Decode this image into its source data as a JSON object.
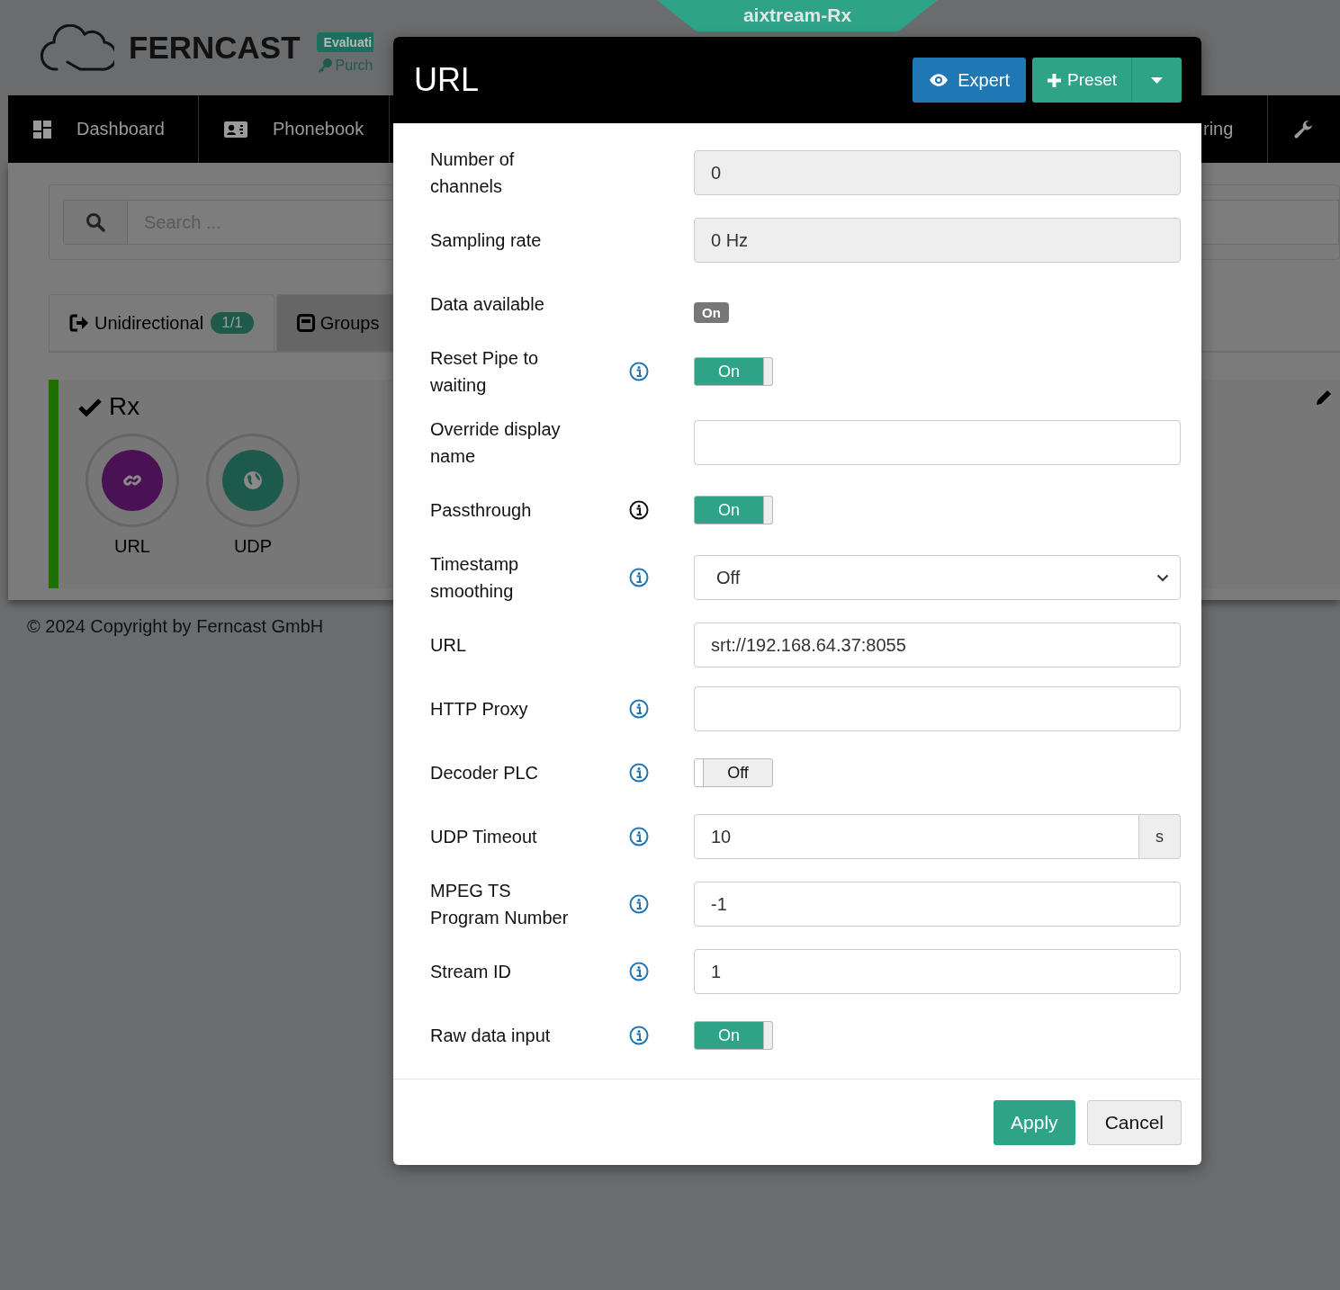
{
  "ribbon": {
    "title": "aixtream-Rx"
  },
  "header": {
    "brand": "FERNCAST",
    "badge": "Evaluati",
    "link": "Purch"
  },
  "nav": {
    "items": [
      {
        "label": "Dashboard"
      },
      {
        "label": "Phonebook"
      },
      {
        "label": "ring"
      }
    ]
  },
  "search": {
    "placeholder": "Search ..."
  },
  "tabs": [
    {
      "label": "Unidirectional",
      "count": "1/1",
      "selected": true
    },
    {
      "label": "Groups",
      "selected": false
    }
  ],
  "device": {
    "name": "Rx",
    "nodes": [
      {
        "label": "URL",
        "color": "#4a1255"
      },
      {
        "label": "UDP",
        "color": "#1d5a4c"
      }
    ]
  },
  "footer": "© 2024 Copyright by Ferncast GmbH",
  "modal": {
    "title": "URL",
    "expert": "Expert",
    "preset": "Preset",
    "apply": "Apply",
    "cancel": "Cancel",
    "fields": [
      {
        "label": "Number of channels",
        "info": false,
        "kind": "readonly",
        "value": "0"
      },
      {
        "label": "Sampling rate",
        "info": false,
        "kind": "readonly",
        "value": "0 Hz"
      },
      {
        "label": "Data available",
        "info": false,
        "kind": "indicator",
        "value": "On"
      },
      {
        "label": "Reset Pipe to waiting",
        "info": true,
        "info_focused": false,
        "kind": "toggle",
        "on": true,
        "value": "On"
      },
      {
        "label": "Override display name",
        "info": false,
        "kind": "text"
      },
      {
        "label": "Passthrough",
        "info": true,
        "info_focused": true,
        "kind": "toggle",
        "on": true,
        "value": "On"
      },
      {
        "label": "Timestamp smoothing",
        "info": true,
        "info_focused": false,
        "kind": "select",
        "value": "Off"
      },
      {
        "label": "URL",
        "info": false,
        "kind": "text",
        "value": "srt://192.168.64.37:8055"
      },
      {
        "label": "HTTP Proxy",
        "info": true,
        "info_focused": false,
        "kind": "text"
      },
      {
        "label": "Decoder PLC",
        "info": true,
        "info_focused": false,
        "kind": "toggle",
        "on": false,
        "value": "Off"
      },
      {
        "label": "UDP Timeout",
        "info": true,
        "info_focused": false,
        "kind": "unit",
        "value": "10",
        "unit": "s"
      },
      {
        "label": "MPEG TS Program Number",
        "info": true,
        "info_focused": false,
        "kind": "text",
        "value": "-1"
      },
      {
        "label": "Stream ID",
        "info": true,
        "info_focused": false,
        "kind": "text",
        "value": "1"
      },
      {
        "label": "Raw data input",
        "info": true,
        "info_focused": false,
        "kind": "toggle",
        "on": true,
        "value": "On"
      }
    ]
  }
}
